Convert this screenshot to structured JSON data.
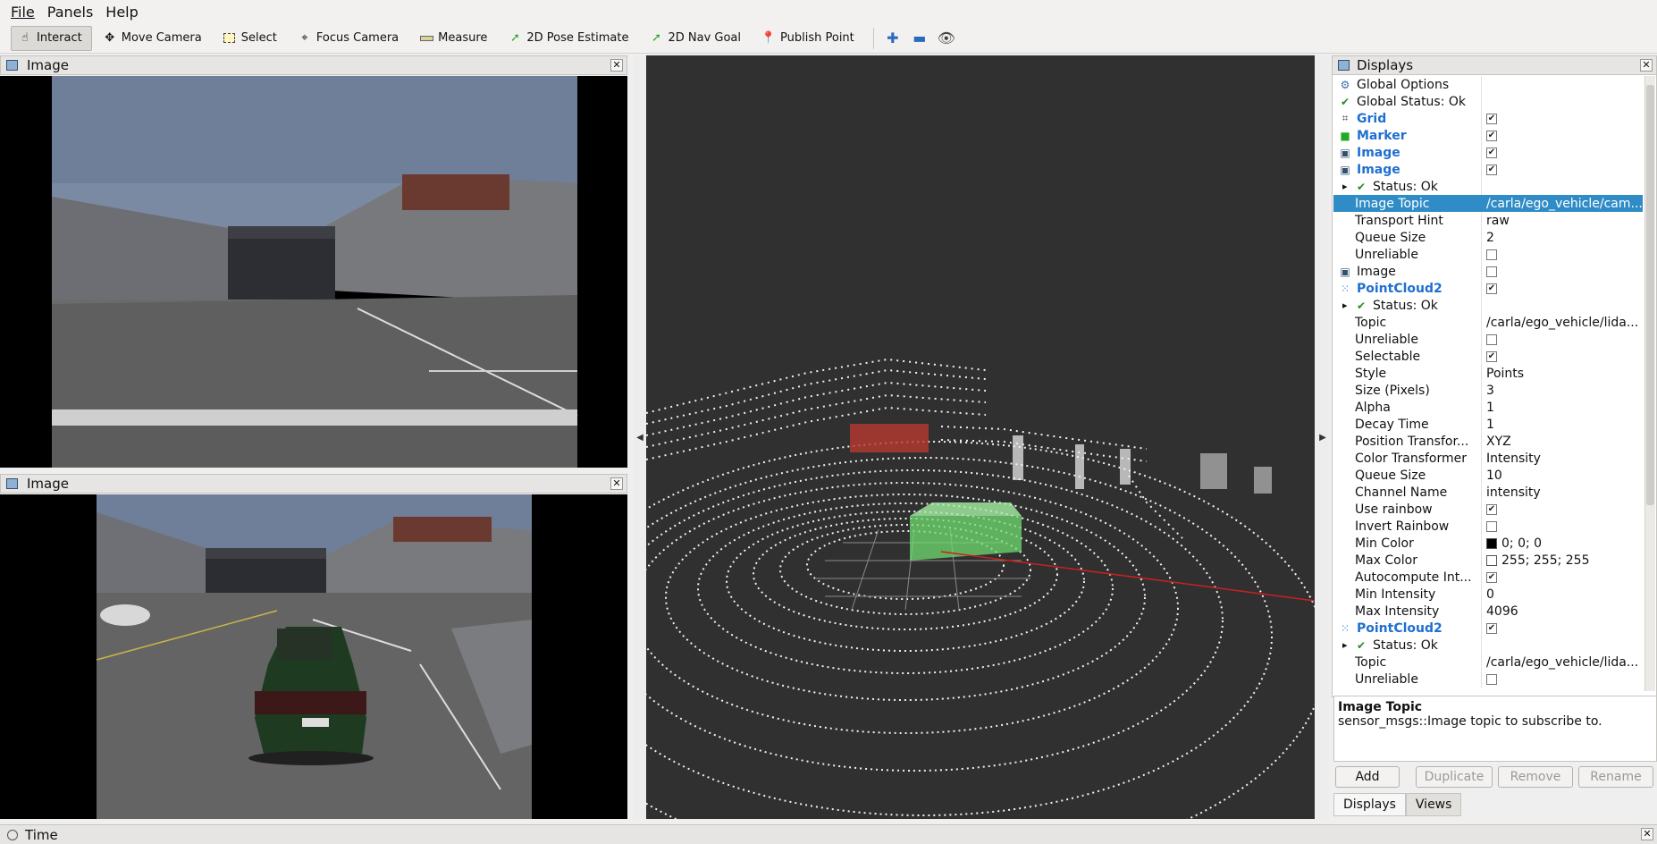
{
  "menu": {
    "file": "File",
    "panels": "Panels",
    "help": "Help"
  },
  "toolbar": {
    "interact": "Interact",
    "move_camera": "Move Camera",
    "select": "Select",
    "focus_camera": "Focus Camera",
    "measure": "Measure",
    "pose_estimate": "2D Pose Estimate",
    "nav_goal": "2D Nav Goal",
    "publish_point": "Publish Point"
  },
  "image_panel_top": {
    "title": "Image"
  },
  "image_panel_bottom": {
    "title": "Image"
  },
  "displays": {
    "title": "Displays",
    "rows": [
      {
        "name": "Global Options",
        "value": "",
        "icon": "gear-icon",
        "indent": 0,
        "style": "normal",
        "check": "none"
      },
      {
        "name": "Global Status: Ok",
        "value": "",
        "icon": "check-icon",
        "indent": 0,
        "style": "normal",
        "check": "none"
      },
      {
        "name": "Grid",
        "value": "",
        "icon": "grid-icon",
        "indent": 0,
        "style": "blue",
        "check": "checked"
      },
      {
        "name": "Marker",
        "value": "",
        "icon": "cube-icon",
        "indent": 0,
        "style": "blue",
        "check": "checked"
      },
      {
        "name": "Image",
        "value": "",
        "icon": "image-icon",
        "indent": 0,
        "style": "blue",
        "check": "checked"
      },
      {
        "name": "Image",
        "value": "",
        "icon": "image-icon",
        "indent": 0,
        "style": "blue",
        "check": "checked"
      },
      {
        "name": "Status: Ok",
        "value": "",
        "icon": "check-icon",
        "indent": 1,
        "style": "normal",
        "check": "none",
        "expander": true
      },
      {
        "name": "Image Topic",
        "value": "/carla/ego_vehicle/cam...",
        "icon": "",
        "indent": 1,
        "style": "selected",
        "check": "none"
      },
      {
        "name": "Transport Hint",
        "value": "raw",
        "icon": "",
        "indent": 1,
        "style": "normal",
        "check": "none"
      },
      {
        "name": "Queue Size",
        "value": "2",
        "icon": "",
        "indent": 1,
        "style": "normal",
        "check": "none"
      },
      {
        "name": "Unreliable",
        "value": "",
        "icon": "",
        "indent": 1,
        "style": "normal",
        "check": "unchecked"
      },
      {
        "name": "Image",
        "value": "",
        "icon": "image-icon",
        "indent": 0,
        "style": "normal",
        "check": "unchecked"
      },
      {
        "name": "PointCloud2",
        "value": "",
        "icon": "pointcloud-icon",
        "indent": 0,
        "style": "blue",
        "check": "checked"
      },
      {
        "name": "Status: Ok",
        "value": "",
        "icon": "check-icon",
        "indent": 1,
        "style": "normal",
        "check": "none",
        "expander": true
      },
      {
        "name": "Topic",
        "value": "/carla/ego_vehicle/lida...",
        "icon": "",
        "indent": 1,
        "style": "normal",
        "check": "none"
      },
      {
        "name": "Unreliable",
        "value": "",
        "icon": "",
        "indent": 1,
        "style": "normal",
        "check": "unchecked"
      },
      {
        "name": "Selectable",
        "value": "",
        "icon": "",
        "indent": 1,
        "style": "normal",
        "check": "checked"
      },
      {
        "name": "Style",
        "value": "Points",
        "icon": "",
        "indent": 1,
        "style": "normal",
        "check": "none"
      },
      {
        "name": "Size (Pixels)",
        "value": "3",
        "icon": "",
        "indent": 1,
        "style": "normal",
        "check": "none"
      },
      {
        "name": "Alpha",
        "value": "1",
        "icon": "",
        "indent": 1,
        "style": "normal",
        "check": "none"
      },
      {
        "name": "Decay Time",
        "value": "1",
        "icon": "",
        "indent": 1,
        "style": "normal",
        "check": "none"
      },
      {
        "name": "Position Transfor...",
        "value": "XYZ",
        "icon": "",
        "indent": 1,
        "style": "normal",
        "check": "none"
      },
      {
        "name": "Color Transformer",
        "value": "Intensity",
        "icon": "",
        "indent": 1,
        "style": "normal",
        "check": "none"
      },
      {
        "name": "Queue Size",
        "value": "10",
        "icon": "",
        "indent": 1,
        "style": "normal",
        "check": "none"
      },
      {
        "name": "Channel Name",
        "value": "intensity",
        "icon": "",
        "indent": 1,
        "style": "normal",
        "check": "none"
      },
      {
        "name": "Use rainbow",
        "value": "",
        "icon": "",
        "indent": 1,
        "style": "normal",
        "check": "checked"
      },
      {
        "name": "Invert Rainbow",
        "value": "",
        "icon": "",
        "indent": 1,
        "style": "normal",
        "check": "unchecked"
      },
      {
        "name": "Min Color",
        "value": "0; 0; 0",
        "icon": "",
        "indent": 1,
        "style": "normal",
        "check": "none",
        "swatch": "#000000"
      },
      {
        "name": "Max Color",
        "value": "255; 255; 255",
        "icon": "",
        "indent": 1,
        "style": "normal",
        "check": "none",
        "swatch": "#ffffff"
      },
      {
        "name": "Autocompute Int...",
        "value": "",
        "icon": "",
        "indent": 1,
        "style": "normal",
        "check": "checked"
      },
      {
        "name": "Min Intensity",
        "value": "0",
        "icon": "",
        "indent": 1,
        "style": "normal",
        "check": "none"
      },
      {
        "name": "Max Intensity",
        "value": "4096",
        "icon": "",
        "indent": 1,
        "style": "normal",
        "check": "none"
      },
      {
        "name": "PointCloud2",
        "value": "",
        "icon": "pointcloud-icon",
        "indent": 0,
        "style": "blue",
        "check": "checked"
      },
      {
        "name": "Status: Ok",
        "value": "",
        "icon": "check-icon",
        "indent": 1,
        "style": "normal",
        "check": "none",
        "expander": true
      },
      {
        "name": "Topic",
        "value": "/carla/ego_vehicle/lida...",
        "icon": "",
        "indent": 1,
        "style": "normal",
        "check": "none"
      },
      {
        "name": "Unreliable",
        "value": "",
        "icon": "",
        "indent": 1,
        "style": "normal",
        "check": "unchecked"
      }
    ],
    "description_title": "Image Topic",
    "description_text": "sensor_msgs::Image topic to subscribe to.",
    "buttons": {
      "add": "Add",
      "duplicate": "Duplicate",
      "remove": "Remove",
      "rename": "Rename"
    },
    "tabs": {
      "displays": "Displays",
      "views": "Views"
    }
  },
  "time_panel": {
    "title": "Time"
  },
  "colors": {
    "selection": "#308cc6",
    "link_blue": "#1f6fd1",
    "viewport_bg": "#303030",
    "marker_green": "#6fdc6f",
    "marker_red": "#c0392b"
  }
}
